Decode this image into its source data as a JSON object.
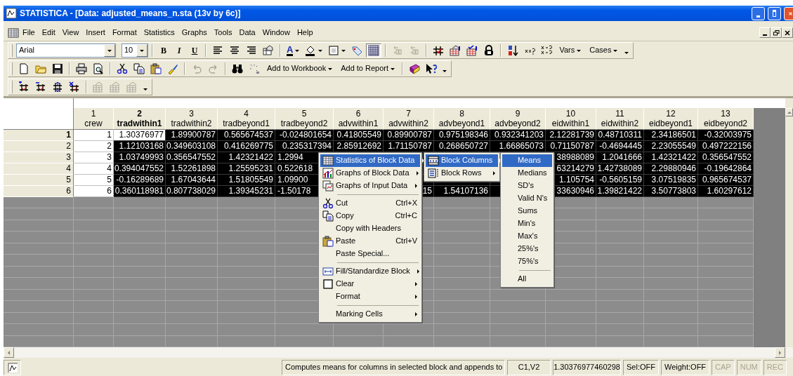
{
  "window": {
    "title": "STATISTICA - [Data: adjusted_means_n.sta (13v by 6c)]"
  },
  "menu_bar": [
    "File",
    "Edit",
    "View",
    "Insert",
    "Format",
    "Statistics",
    "Graphs",
    "Tools",
    "Data",
    "Window",
    "Help"
  ],
  "format_toolbar": {
    "font": "Arial",
    "size": "10",
    "style_buttons": [
      "B",
      "I",
      "U"
    ],
    "font_color_letter": "A",
    "menus": [
      "Vars",
      "Cases"
    ]
  },
  "standard_toolbar": {
    "menus": [
      "Add to Workbook",
      "Add to Report"
    ]
  },
  "spreadsheet": {
    "columns": [
      {
        "number": "1",
        "name": "crew",
        "current": false,
        "selected": false
      },
      {
        "number": "2",
        "name": "tradwithin1",
        "current": true,
        "selected": true
      },
      {
        "number": "3",
        "name": "tradwithin2",
        "current": false,
        "selected": true
      },
      {
        "number": "4",
        "name": "tradbeyond1",
        "current": false,
        "selected": true
      },
      {
        "number": "5",
        "name": "tradbeyond2",
        "current": false,
        "selected": true
      },
      {
        "number": "6",
        "name": "advwithin1",
        "current": false,
        "selected": true
      },
      {
        "number": "7",
        "name": "advwithin2",
        "current": false,
        "selected": true
      },
      {
        "number": "8",
        "name": "advbeyond1",
        "current": false,
        "selected": true
      },
      {
        "number": "9",
        "name": "advbeyond2",
        "current": false,
        "selected": true
      },
      {
        "number": "10",
        "name": "eidwithin1",
        "current": false,
        "selected": true
      },
      {
        "number": "11",
        "name": "eidwithin2",
        "current": false,
        "selected": true
      },
      {
        "number": "12",
        "name": "eidbeyond1",
        "current": false,
        "selected": true
      },
      {
        "number": "13",
        "name": "eidbeyond2",
        "current": false,
        "selected": true
      }
    ],
    "rows": [
      {
        "label": "1",
        "current": true,
        "selected": true,
        "cells": [
          "1",
          "1.30376977",
          "1.89900787",
          "0.565674537",
          "-0.024801654",
          "0.41805549",
          "0.89900787",
          "0.975198346",
          "0.932341203",
          "2.12281739",
          "0.48710311",
          "2.34186501",
          "-0.32003975"
        ]
      },
      {
        "label": "2",
        "current": false,
        "selected": true,
        "cells": [
          "2",
          "1.12103168",
          "0.349603108",
          "0.416269775",
          "0.235317394",
          "2.85912692",
          "1.71150787",
          "0.268650727",
          "1.66865073",
          "0.71150787",
          "-0.4694445",
          "2.23055549",
          "0.497222156"
        ]
      },
      {
        "label": "3",
        "current": false,
        "selected": true,
        "cells": [
          "3",
          "1.03749993",
          "0.356547552",
          "1.42321422",
          {
            "text": "1.2994",
            "kind": "clipped"
          },
          null,
          null,
          null,
          null,
          "38988089",
          "1.2041666",
          "1.42321422",
          "0.356547552"
        ]
      },
      {
        "label": "4",
        "current": false,
        "selected": true,
        "cells": [
          "4",
          "0.394047552",
          "1.52261898",
          "1.25595231",
          {
            "text": "0.522618",
            "kind": "clipped"
          },
          null,
          null,
          null,
          null,
          "63214279",
          "1.42738089",
          "2.29880946",
          "-0.19642864"
        ]
      },
      {
        "label": "5",
        "current": false,
        "selected": true,
        "cells": [
          "5",
          "-0.16289689",
          "1.67043644",
          "1.51805549",
          {
            "text": "1.09900",
            "kind": "clipped"
          },
          null,
          {
            "kind": "covered"
          },
          {
            "kind": "covered"
          },
          {
            "kind": "covered"
          },
          "1.105754",
          "-0.5605159",
          "3.07519835",
          "0.965674537"
        ]
      },
      {
        "label": "6",
        "current": false,
        "selected": true,
        "cells": [
          "6",
          "0.360118981",
          "0.807738029",
          "1.39345231",
          {
            "text": "-1.50178",
            "kind": "clipped"
          },
          null,
          "15",
          "1.54107136",
          {
            "kind": "covered"
          },
          "33630946",
          "1.39821422",
          "3.50773803",
          "1.60297612"
        ]
      }
    ]
  },
  "context_menu": {
    "items": [
      {
        "kind": "item",
        "label": "Statistics of Block Data",
        "submenu": true,
        "selected": true
      },
      {
        "kind": "item",
        "label": "Graphs of Block Data",
        "submenu": true,
        "selected": false
      },
      {
        "kind": "item",
        "label": "Graphs of Input Data",
        "submenu": true,
        "selected": false
      },
      {
        "kind": "separator"
      },
      {
        "kind": "item",
        "label": "Cut",
        "shortcut": "Ctrl+X",
        "submenu": false,
        "selected": false
      },
      {
        "kind": "item",
        "label": "Copy",
        "shortcut": "Ctrl+C",
        "submenu": false,
        "selected": false
      },
      {
        "kind": "item",
        "label": "Copy with Headers",
        "submenu": false,
        "selected": false
      },
      {
        "kind": "item",
        "label": "Paste",
        "shortcut": "Ctrl+V",
        "submenu": false,
        "selected": false
      },
      {
        "kind": "item",
        "label": "Paste Special...",
        "submenu": false,
        "selected": false
      },
      {
        "kind": "separator"
      },
      {
        "kind": "item",
        "label": "Fill/Standardize Block",
        "submenu": true,
        "selected": false
      },
      {
        "kind": "item",
        "label": "Clear",
        "submenu": true,
        "selected": false
      },
      {
        "kind": "item",
        "label": "Format",
        "submenu": true,
        "selected": false
      },
      {
        "kind": "separator"
      },
      {
        "kind": "item",
        "label": "Marking Cells",
        "submenu": true,
        "selected": false
      }
    ]
  },
  "block_submenu": {
    "items": [
      {
        "kind": "item",
        "label": "Block Columns",
        "submenu": true,
        "selected": true
      },
      {
        "kind": "item",
        "label": "Block Rows",
        "submenu": true,
        "selected": false
      }
    ]
  },
  "columns_submenu": {
    "items": [
      {
        "kind": "item",
        "label": "Means",
        "submenu": false,
        "selected": true
      },
      {
        "kind": "item",
        "label": "Medians",
        "submenu": false,
        "selected": false
      },
      {
        "kind": "item",
        "label": "SD's",
        "submenu": false,
        "selected": false
      },
      {
        "kind": "item",
        "label": "Valid N's",
        "submenu": false,
        "selected": false
      },
      {
        "kind": "item",
        "label": "Sums",
        "submenu": false,
        "selected": false
      },
      {
        "kind": "item",
        "label": "Min's",
        "submenu": false,
        "selected": false
      },
      {
        "kind": "item",
        "label": "Max's",
        "submenu": false,
        "selected": false
      },
      {
        "kind": "item",
        "label": "25%'s",
        "submenu": false,
        "selected": false
      },
      {
        "kind": "item",
        "label": "75%'s",
        "submenu": false,
        "selected": false
      },
      {
        "kind": "separator"
      },
      {
        "kind": "item",
        "label": "All",
        "submenu": false,
        "selected": false
      }
    ]
  },
  "status_bar": {
    "message": "Computes means for columns in selected block and appends to",
    "cell": "C1,V2",
    "value": "1.30376977460298",
    "indicators": [
      {
        "label": "Sel:OFF",
        "enabled": true
      },
      {
        "label": "Weight:OFF",
        "enabled": true
      },
      {
        "label": "CAP",
        "enabled": false
      },
      {
        "label": "NUM",
        "enabled": false
      },
      {
        "label": "REC",
        "enabled": false
      }
    ]
  }
}
